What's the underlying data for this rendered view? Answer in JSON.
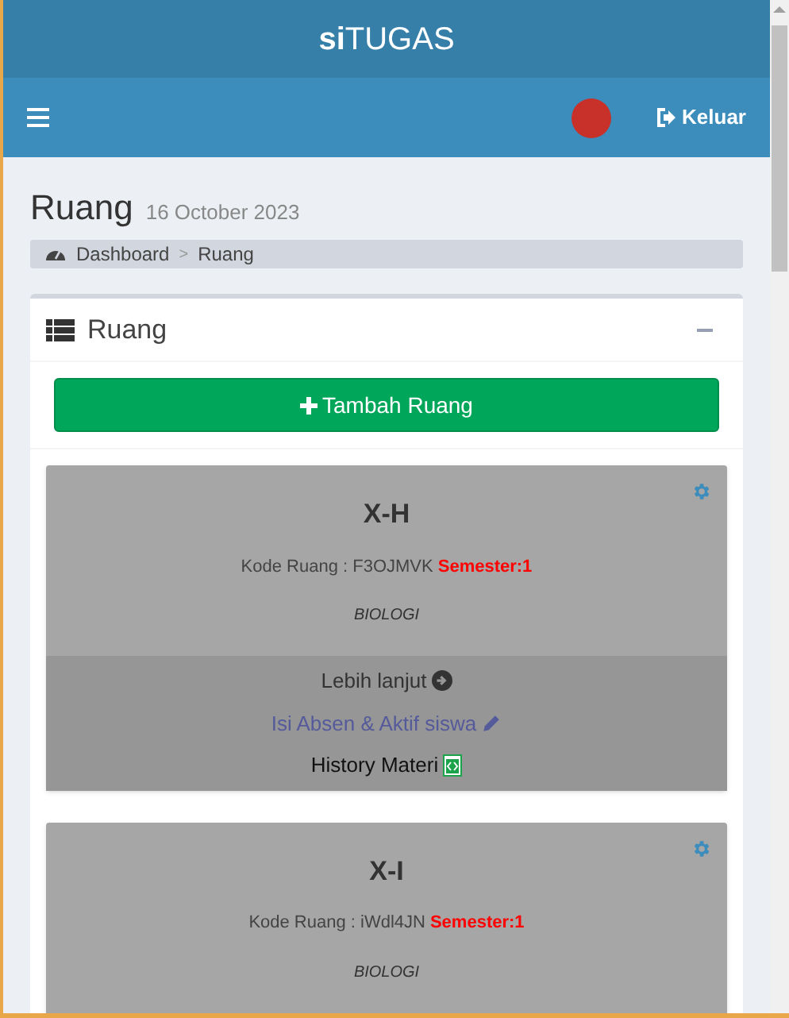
{
  "app_title": "**si**TUGAS",
  "navbar": {
    "logout": "Keluar"
  },
  "page": {
    "title": "Ruang",
    "date": "16 October 2023"
  },
  "breadcrumb": [
    {
      "label": "Dashboard",
      "kind": "home"
    },
    {
      "label": ">",
      "kind": "separator"
    },
    {
      "label": "Ruang",
      "kind": "current"
    }
  ],
  "box": {
    "title": "Ruang",
    "add_button": "Tambah Ruang"
  },
  "rooms": [
    {
      "name": "X-H",
      "code_label": "Kode Ruang : F3OJMVK",
      "semester": "Semester:1",
      "subject": "BIOLOGI",
      "links": [
        {
          "label": "Lebih lanjut",
          "kind": "more"
        },
        {
          "label": "Isi Absen & Aktif siswa",
          "kind": "attendance"
        },
        {
          "label": "History Materi",
          "kind": "history"
        }
      ]
    },
    {
      "name": "X-I",
      "code_label": "Kode Ruang : iWdl4JN",
      "semester": "Semester:1",
      "subject": "BIOLOGI"
    }
  ]
}
